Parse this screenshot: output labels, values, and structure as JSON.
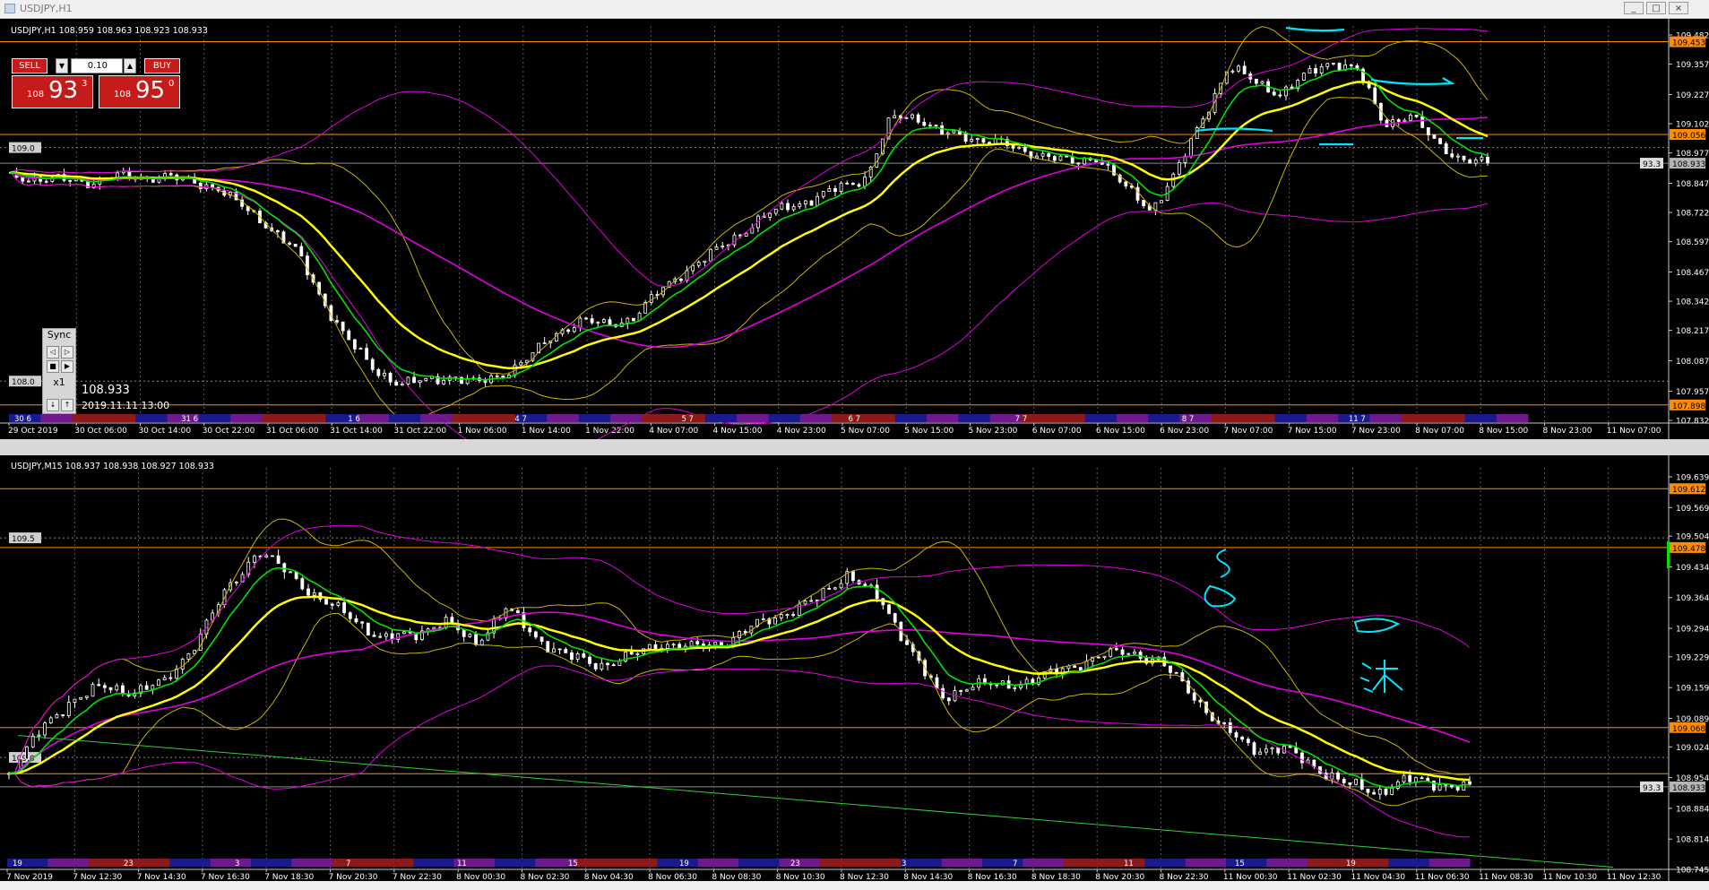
{
  "window": {
    "title": "USDJPY,H1",
    "buttons": [
      "_",
      "□",
      "×"
    ]
  },
  "trade_panel": {
    "sell_label": "SELL",
    "buy_label": "BUY",
    "lot": "0.10",
    "sell_prefix": "108",
    "sell_big": "93",
    "sell_sup": "3",
    "buy_prefix": "108",
    "buy_big": "95",
    "buy_sup": "0"
  },
  "sync_panel": {
    "label": "Sync",
    "speed": "x1",
    "price": "108.933",
    "datetime": "2019.11.11 13:00"
  },
  "colors": {
    "background": "#000000",
    "grid": "#5a5a5a",
    "candle": "#ffffff",
    "ema_fast": "#00e000",
    "ema_slow": "#ffff00",
    "ma_long": "#e000e0",
    "bands": "#c8b400",
    "level_line": "#ff8c00",
    "annotation": "#00e5ff",
    "trend_line": "#32cd32"
  },
  "chart_data": [
    {
      "type": "line",
      "title": "USDJPY,H1",
      "ohlc_header": "108.959 108.963 108.923 108.933",
      "ylim": [
        107.832,
        109.482
      ],
      "y_ticks": [
        "109.482",
        "109.357",
        "109.227",
        "109.102",
        "108.977",
        "108.847",
        "108.722",
        "108.597",
        "108.467",
        "108.342",
        "108.217",
        "108.087",
        "107.957",
        "107.832"
      ],
      "price_labels": [
        {
          "text": "109.453",
          "color": "#ff8c00"
        },
        {
          "text": "109.056",
          "color": "#ff8c00"
        },
        {
          "text": "108.933",
          "color": "#b4b4b4"
        },
        {
          "text": "107.898",
          "color": "#ff8c00"
        }
      ],
      "level_lines": [
        109.453,
        109.056,
        107.898
      ],
      "dotted_levels": [
        {
          "value": 109.0,
          "label": "109.0"
        },
        {
          "value": 108.0,
          "label": "108.0"
        }
      ],
      "current_price": 108.933,
      "current_tag": "93.3",
      "x_labels": [
        "29 Oct 2019",
        "30 Oct 06:00",
        "30 Oct 14:00",
        "30 Oct 22:00",
        "31 Oct 06:00",
        "31 Oct 14:00",
        "31 Oct 22:00",
        "1 Nov 06:00",
        "1 Nov 14:00",
        "1 Nov 22:00",
        "4 Nov 07:00",
        "4 Nov 15:00",
        "4 Nov 23:00",
        "5 Nov 07:00",
        "5 Nov 15:00",
        "5 Nov 23:00",
        "6 Nov 07:00",
        "6 Nov 15:00",
        "6 Nov 23:00",
        "7 Nov 07:00",
        "7 Nov 15:00",
        "7 Nov 23:00",
        "8 Nov 07:00",
        "8 Nov 15:00",
        "8 Nov 23:00",
        "11 Nov 07:00"
      ],
      "session_labels": [
        "30 6",
        "31 6",
        "1 6",
        "4 7",
        "5 7",
        "6 7",
        "7 7",
        "8 7",
        "11 7"
      ],
      "series": [
        {
          "name": "",
          "values": [
            108.87,
            108.87,
            108.86,
            108.85,
            108.88,
            108.87,
            108.88,
            108.85,
            108.83,
            108.74,
            108.66,
            108.56,
            108.35,
            108.18,
            108.05,
            107.99,
            108.0,
            108.02,
            107.99,
            108.03,
            108.1,
            108.2,
            108.26,
            108.24,
            108.27,
            108.38,
            108.47,
            108.54,
            108.62,
            108.7,
            108.75,
            108.78,
            108.83,
            108.87,
            109.13,
            109.13,
            109.06,
            109.04,
            109.03,
            108.98,
            108.97,
            108.93,
            108.96,
            108.83,
            108.73,
            108.9,
            109.12,
            109.35,
            109.28,
            109.23,
            109.31,
            109.37,
            109.33,
            109.1,
            109.14,
            109.02,
            108.95,
            108.93
          ]
        }
      ]
    },
    {
      "type": "line",
      "title": "USDJPY,M15",
      "ohlc_header": "108.937 108.938 108.927 108.933",
      "ylim": [
        108.745,
        109.639
      ],
      "y_ticks": [
        "109.639",
        "109.569",
        "109.504",
        "109.434",
        "109.364",
        "109.294",
        "109.229",
        "109.159",
        "109.089",
        "109.024",
        "108.954",
        "108.884",
        "108.814",
        "108.745"
      ],
      "price_labels": [
        {
          "text": "109.612",
          "color": "#ff8c00"
        },
        {
          "text": "109.478",
          "color": "#ff8c00"
        },
        {
          "text": "109.068",
          "color": "#ff8c00"
        },
        {
          "text": "108.933",
          "color": "#b4b4b4"
        }
      ],
      "level_lines": [
        109.612,
        109.478,
        109.068,
        108.963
      ],
      "dotted_levels": [
        {
          "value": 109.5,
          "label": "109.5"
        },
        {
          "value": 109.0,
          "label": "109.0"
        }
      ],
      "current_price": 108.933,
      "current_tag": "93.3",
      "x_labels": [
        "7 Nov 2019",
        "7 Nov 12:30",
        "7 Nov 14:30",
        "7 Nov 16:30",
        "7 Nov 18:30",
        "7 Nov 20:30",
        "7 Nov 22:30",
        "8 Nov 00:30",
        "8 Nov 02:30",
        "8 Nov 04:30",
        "8 Nov 06:30",
        "8 Nov 08:30",
        "8 Nov 10:30",
        "8 Nov 12:30",
        "8 Nov 14:30",
        "8 Nov 16:30",
        "8 Nov 18:30",
        "8 Nov 20:30",
        "8 Nov 22:30",
        "11 Nov 00:30",
        "11 Nov 02:30",
        "11 Nov 04:30",
        "11 Nov 06:30",
        "11 Nov 08:30",
        "11 Nov 10:30",
        "11 Nov 12:30"
      ],
      "session_labels": [
        "19",
        "23",
        "3",
        "7",
        "11",
        "15",
        "19",
        "23",
        "3",
        "7",
        "11",
        "15",
        "19"
      ],
      "series": [
        {
          "name": "",
          "values": [
            108.96,
            109.06,
            109.13,
            109.16,
            109.15,
            109.17,
            109.26,
            109.38,
            109.47,
            109.42,
            109.36,
            109.32,
            109.27,
            109.28,
            109.31,
            109.26,
            109.34,
            109.27,
            109.23,
            109.21,
            109.23,
            109.26,
            109.25,
            109.26,
            109.3,
            109.33,
            109.36,
            109.42,
            109.36,
            109.25,
            109.13,
            109.17,
            109.16,
            109.18,
            109.2,
            109.23,
            109.24,
            109.22,
            109.15,
            109.07,
            109.02,
            109.02,
            108.98,
            108.94,
            108.92,
            108.95,
            108.94,
            108.93
          ]
        }
      ]
    }
  ]
}
